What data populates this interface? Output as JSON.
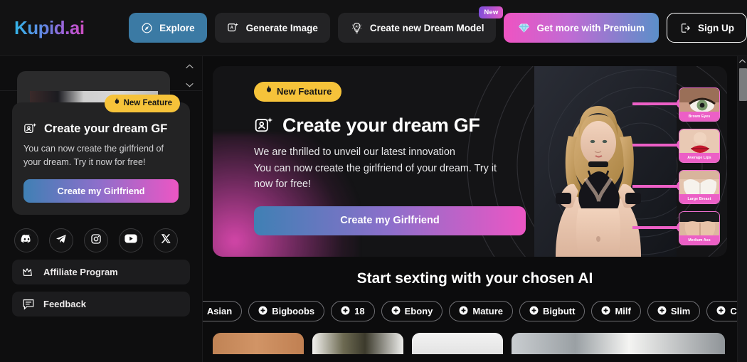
{
  "nav": {
    "logo": "Kupid.ai",
    "buttons": [
      {
        "label": "Explore",
        "icon": "compass-icon",
        "style": "explore"
      },
      {
        "label": "Generate Image",
        "icon": "image-sparkle-icon",
        "style": "plain"
      },
      {
        "label": "Create new Dream Model",
        "icon": "ai-bulb-icon",
        "style": "plain",
        "badge": "New"
      },
      {
        "label": "Get more with Premium",
        "icon": "diamond-icon",
        "style": "premium"
      },
      {
        "label": "Sign Up",
        "icon": "login-icon",
        "style": "signup"
      }
    ]
  },
  "sidebar": {
    "promo": {
      "badge": "New Feature",
      "badge_icon": "flame-icon",
      "title": "Create your dream GF",
      "title_icon": "avatar-sparkle-icon",
      "description": "You can now create the girlfriend of your dream. Try it now for free!",
      "cta": "Create my Girlfriend"
    },
    "socials": [
      {
        "name": "discord-icon"
      },
      {
        "name": "telegram-icon"
      },
      {
        "name": "instagram-icon"
      },
      {
        "name": "youtube-icon"
      },
      {
        "name": "x-twitter-icon"
      }
    ],
    "items": [
      {
        "label": "Affiliate Program",
        "icon": "crown-icon"
      },
      {
        "label": "Feedback",
        "icon": "message-icon"
      }
    ]
  },
  "hero": {
    "badge": "New Feature",
    "badge_icon": "flame-icon",
    "title": "Create your dream GF",
    "title_icon": "avatar-sparkle-icon",
    "desc_line1": "We are thrilled to unveil our latest innovation",
    "desc_line2": "You can now create the girlfriend of your dream. Try it",
    "desc_line3": "now for free!",
    "cta": "Create my Girlfriend",
    "callouts": [
      {
        "label": "Brown Eyes"
      },
      {
        "label": "Average Lips"
      },
      {
        "label": "Large Breast"
      },
      {
        "label": "Medium Ass"
      }
    ]
  },
  "section": {
    "title": "Start sexting with your chosen AI",
    "tags": [
      "Asian",
      "Bigboobs",
      "18",
      "Ebony",
      "Mature",
      "Bigbutt",
      "Milf",
      "Slim",
      "Curvy"
    ]
  },
  "colors": {
    "accent_pink": "#ec5fc6",
    "accent_blue": "#3b7aa4",
    "badge_yellow": "#f6c33a",
    "bg": "#0c0c0d"
  }
}
